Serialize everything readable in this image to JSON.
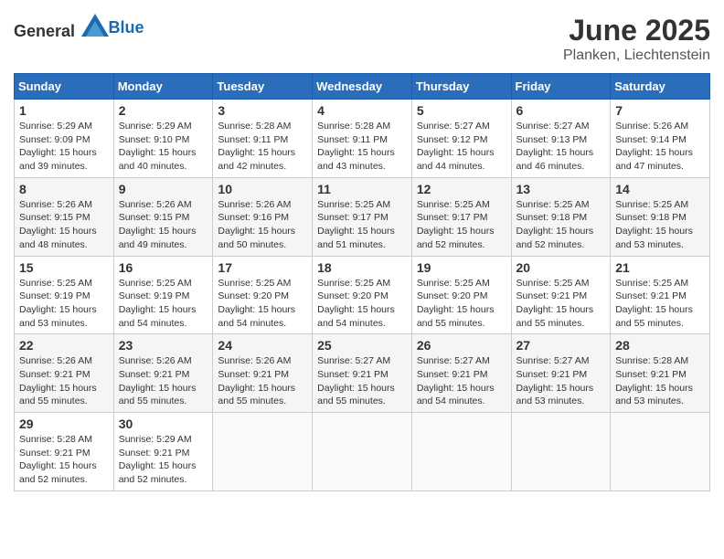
{
  "header": {
    "logo_general": "General",
    "logo_blue": "Blue",
    "month": "June 2025",
    "location": "Planken, Liechtenstein"
  },
  "weekdays": [
    "Sunday",
    "Monday",
    "Tuesday",
    "Wednesday",
    "Thursday",
    "Friday",
    "Saturday"
  ],
  "weeks": [
    [
      {
        "day": "1",
        "sunrise": "5:29 AM",
        "sunset": "9:09 PM",
        "daylight": "15 hours and 39 minutes."
      },
      {
        "day": "2",
        "sunrise": "5:29 AM",
        "sunset": "9:10 PM",
        "daylight": "15 hours and 40 minutes."
      },
      {
        "day": "3",
        "sunrise": "5:28 AM",
        "sunset": "9:11 PM",
        "daylight": "15 hours and 42 minutes."
      },
      {
        "day": "4",
        "sunrise": "5:28 AM",
        "sunset": "9:11 PM",
        "daylight": "15 hours and 43 minutes."
      },
      {
        "day": "5",
        "sunrise": "5:27 AM",
        "sunset": "9:12 PM",
        "daylight": "15 hours and 44 minutes."
      },
      {
        "day": "6",
        "sunrise": "5:27 AM",
        "sunset": "9:13 PM",
        "daylight": "15 hours and 46 minutes."
      },
      {
        "day": "7",
        "sunrise": "5:26 AM",
        "sunset": "9:14 PM",
        "daylight": "15 hours and 47 minutes."
      }
    ],
    [
      {
        "day": "8",
        "sunrise": "5:26 AM",
        "sunset": "9:15 PM",
        "daylight": "15 hours and 48 minutes."
      },
      {
        "day": "9",
        "sunrise": "5:26 AM",
        "sunset": "9:15 PM",
        "daylight": "15 hours and 49 minutes."
      },
      {
        "day": "10",
        "sunrise": "5:26 AM",
        "sunset": "9:16 PM",
        "daylight": "15 hours and 50 minutes."
      },
      {
        "day": "11",
        "sunrise": "5:25 AM",
        "sunset": "9:17 PM",
        "daylight": "15 hours and 51 minutes."
      },
      {
        "day": "12",
        "sunrise": "5:25 AM",
        "sunset": "9:17 PM",
        "daylight": "15 hours and 52 minutes."
      },
      {
        "day": "13",
        "sunrise": "5:25 AM",
        "sunset": "9:18 PM",
        "daylight": "15 hours and 52 minutes."
      },
      {
        "day": "14",
        "sunrise": "5:25 AM",
        "sunset": "9:18 PM",
        "daylight": "15 hours and 53 minutes."
      }
    ],
    [
      {
        "day": "15",
        "sunrise": "5:25 AM",
        "sunset": "9:19 PM",
        "daylight": "15 hours and 53 minutes."
      },
      {
        "day": "16",
        "sunrise": "5:25 AM",
        "sunset": "9:19 PM",
        "daylight": "15 hours and 54 minutes."
      },
      {
        "day": "17",
        "sunrise": "5:25 AM",
        "sunset": "9:20 PM",
        "daylight": "15 hours and 54 minutes."
      },
      {
        "day": "18",
        "sunrise": "5:25 AM",
        "sunset": "9:20 PM",
        "daylight": "15 hours and 54 minutes."
      },
      {
        "day": "19",
        "sunrise": "5:25 AM",
        "sunset": "9:20 PM",
        "daylight": "15 hours and 55 minutes."
      },
      {
        "day": "20",
        "sunrise": "5:25 AM",
        "sunset": "9:21 PM",
        "daylight": "15 hours and 55 minutes."
      },
      {
        "day": "21",
        "sunrise": "5:25 AM",
        "sunset": "9:21 PM",
        "daylight": "15 hours and 55 minutes."
      }
    ],
    [
      {
        "day": "22",
        "sunrise": "5:26 AM",
        "sunset": "9:21 PM",
        "daylight": "15 hours and 55 minutes."
      },
      {
        "day": "23",
        "sunrise": "5:26 AM",
        "sunset": "9:21 PM",
        "daylight": "15 hours and 55 minutes."
      },
      {
        "day": "24",
        "sunrise": "5:26 AM",
        "sunset": "9:21 PM",
        "daylight": "15 hours and 55 minutes."
      },
      {
        "day": "25",
        "sunrise": "5:27 AM",
        "sunset": "9:21 PM",
        "daylight": "15 hours and 55 minutes."
      },
      {
        "day": "26",
        "sunrise": "5:27 AM",
        "sunset": "9:21 PM",
        "daylight": "15 hours and 54 minutes."
      },
      {
        "day": "27",
        "sunrise": "5:27 AM",
        "sunset": "9:21 PM",
        "daylight": "15 hours and 53 minutes."
      },
      {
        "day": "28",
        "sunrise": "5:28 AM",
        "sunset": "9:21 PM",
        "daylight": "15 hours and 53 minutes."
      }
    ],
    [
      {
        "day": "29",
        "sunrise": "5:28 AM",
        "sunset": "9:21 PM",
        "daylight": "15 hours and 52 minutes."
      },
      {
        "day": "30",
        "sunrise": "5:29 AM",
        "sunset": "9:21 PM",
        "daylight": "15 hours and 52 minutes."
      },
      null,
      null,
      null,
      null,
      null
    ]
  ],
  "labels": {
    "sunrise": "Sunrise:",
    "sunset": "Sunset:",
    "daylight": "Daylight:"
  }
}
